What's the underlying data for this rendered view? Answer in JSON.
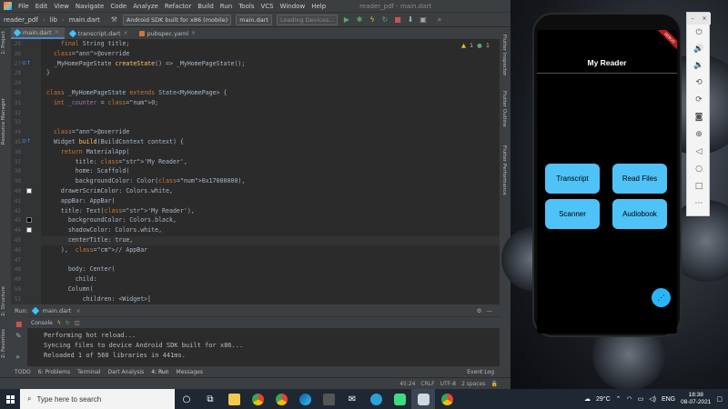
{
  "ide": {
    "menu": [
      "File",
      "Edit",
      "View",
      "Navigate",
      "Code",
      "Analyze",
      "Refactor",
      "Build",
      "Run",
      "Tools",
      "VCS",
      "Window",
      "Help"
    ],
    "window_title": "reader_pdf - main.dart",
    "breadcrumbs": [
      "reader_pdf",
      "lib",
      "main.dart"
    ],
    "device_selector": "Android SDK built for x86 (mobile)",
    "run_config": "main.dart",
    "loading_devices": "Loading Devices...",
    "tabs": [
      {
        "label": "main.dart",
        "active": true
      },
      {
        "label": "transcript.dart",
        "active": false
      },
      {
        "label": "pubspec.yaml",
        "active": false
      }
    ],
    "left_strip": [
      "1: Project",
      "Resource Manager",
      "2: Structure",
      "2: Favorites"
    ],
    "right_strip": [
      "Flutter Inspector",
      "Flutter Outline",
      "Flutter Performance"
    ],
    "warnings": "1",
    "infos": "1",
    "code_lines": [
      {
        "n": "25",
        "t": "    final String title;"
      },
      {
        "n": "26",
        "t": "  @override"
      },
      {
        "n": "27",
        "t": "  _MyHomePageState createState() => _MyHomePageState();"
      },
      {
        "n": "28",
        "t": "}"
      },
      {
        "n": "29",
        "t": ""
      },
      {
        "n": "30",
        "t": "class _MyHomePageState extends State<MyHomePage> {"
      },
      {
        "n": "31",
        "t": "  int _counter = 0;"
      },
      {
        "n": "32",
        "t": ""
      },
      {
        "n": "33",
        "t": ""
      },
      {
        "n": "34",
        "t": "  @override"
      },
      {
        "n": "35",
        "t": "  Widget build(BuildContext context) {"
      },
      {
        "n": "36",
        "t": "    return MaterialApp("
      },
      {
        "n": "37",
        "t": "        title: 'My Reader',"
      },
      {
        "n": "38",
        "t": "        home: Scaffold("
      },
      {
        "n": "39",
        "t": "        backgroundColor: Color(0x17000000),"
      },
      {
        "n": "40",
        "t": "    drawerScrimColor: Colors.white,"
      },
      {
        "n": "41",
        "t": "    appBar: AppBar("
      },
      {
        "n": "42",
        "t": "    title: Text('My Reader'),"
      },
      {
        "n": "43",
        "t": "      backgroundColor: Colors.black,"
      },
      {
        "n": "44",
        "t": "      shadowColor: Colors.white,"
      },
      {
        "n": "45",
        "t": "      centerTitle: true,"
      },
      {
        "n": "46",
        "t": "    ),  // AppBar"
      },
      {
        "n": "47",
        "t": ""
      },
      {
        "n": "48",
        "t": "      body: Center("
      },
      {
        "n": "49",
        "t": "        child:"
      },
      {
        "n": "50",
        "t": "      Column("
      },
      {
        "n": "51",
        "t": "          children: <Widget>["
      }
    ],
    "run_panel": {
      "label": "Run:",
      "config": "main.dart",
      "console_tab": "Console",
      "lines": [
        "Performing hot reload...",
        "Syncing files to device Android SDK built for x86...",
        "Reloaded 1 of 560 libraries in 441ms."
      ]
    },
    "tool_windows": [
      "TODO",
      "6: Problems",
      "Terminal",
      "Dart Analysis",
      "4: Run",
      "Messages"
    ],
    "status": {
      "event_log": "Event Log",
      "position": "45:24",
      "line_sep": "CRLF",
      "encoding": "UTF-8",
      "indent": "2 spaces"
    }
  },
  "emulator": {
    "app_title": "My Reader",
    "debug_banner": "DEBUG",
    "buttons": [
      "Transcript",
      "Read Files",
      "Scanner",
      "Audiobook"
    ],
    "toolbar_icons": [
      "power-icon",
      "volume-up-icon",
      "volume-down-icon",
      "rotate-left-icon",
      "rotate-right-icon",
      "camera-icon",
      "zoom-icon",
      "back-icon",
      "home-icon",
      "overview-icon",
      "more-icon"
    ]
  },
  "taskbar": {
    "search_placeholder": "Type here to search",
    "weather": "29°C",
    "language": "ENG",
    "time": "18:38",
    "date": "08-07-2021"
  },
  "colors": {
    "accent_button": "#4fc3f7",
    "ide_bg": "#2b2b2b",
    "taskbar": "#1f2733"
  }
}
